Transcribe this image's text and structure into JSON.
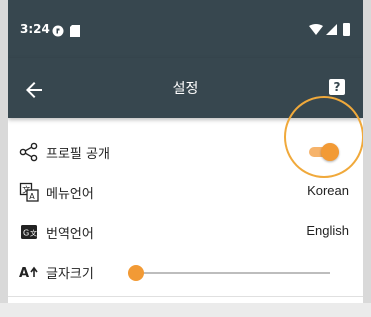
{
  "status_bar": {
    "time": "3:24",
    "icons_left": [
      "circle-notification-icon",
      "sd-card-icon"
    ],
    "icons_right": [
      "wifi-icon",
      "signal-icon",
      "battery-icon"
    ]
  },
  "app_bar": {
    "title": "설정",
    "back_icon": "arrow-left-icon",
    "help_label": "?",
    "background": "#37474f"
  },
  "settings": [
    {
      "id": "profile",
      "icon": "share-icon",
      "label": "프로필 공개",
      "control": "toggle",
      "enabled": true
    },
    {
      "id": "menu_language",
      "icon": "translate-icon",
      "label": "메뉴언어",
      "value": "Korean"
    },
    {
      "id": "translation_language",
      "icon": "translate-box-icon",
      "label": "번역언어",
      "value": "English"
    },
    {
      "id": "font_size",
      "icon": "font-size-icon",
      "label": "글자크기",
      "control": "slider",
      "level": 0
    }
  ],
  "accent_color": "#f29a35"
}
